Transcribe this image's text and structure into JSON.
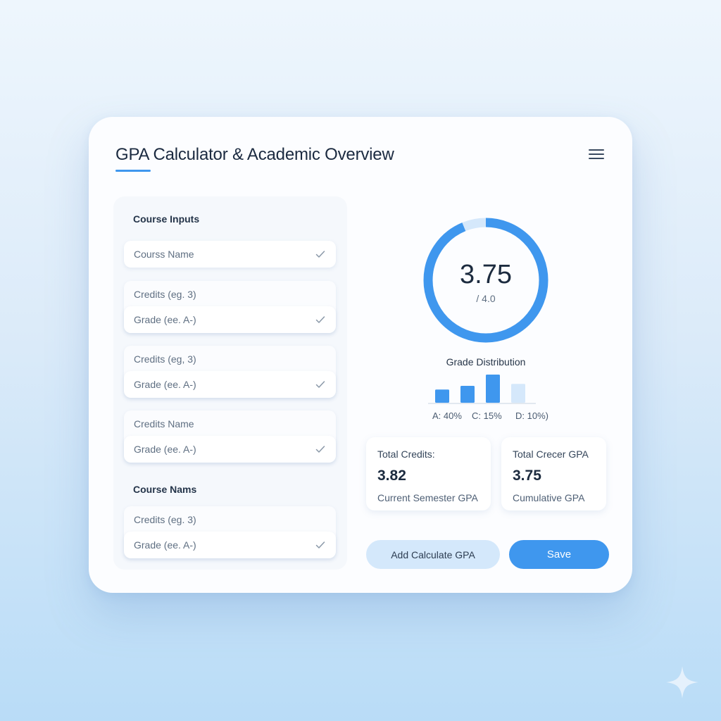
{
  "header": {
    "title": "GPA Calculator & Academic Overview",
    "menu_icon": "hamburger-menu-icon"
  },
  "course_panel": {
    "section1_title": "Course Inputs",
    "course_name_placeholder": "Courss Name",
    "rows": [
      {
        "top": "Credits (eg. 3)",
        "bottom": "Grade (ee. A-)"
      },
      {
        "top": "Credits (eg, 3)",
        "bottom": "Grade (ee. A-)"
      },
      {
        "top": "Credits Name",
        "bottom": "Grade (ee. A-)"
      }
    ],
    "section2_title": "Course Nams",
    "last_row": {
      "top": "Credits (eg. 3)",
      "bottom": "Grade (ee. A-)"
    },
    "field_icon": "check-icon"
  },
  "gpa_ring": {
    "value": "3.75",
    "scale": "/ 4.0",
    "fill_fraction": 0.9375,
    "fill_color": "#3f97ee",
    "track_color": "#d5e8fb"
  },
  "distribution": {
    "title": "Grade Distribution",
    "labels": [
      "A: 40%",
      "C: 15%",
      "D: 10%)"
    ],
    "bar_relative_heights": [
      0.47,
      0.6,
      1.0,
      0.67
    ],
    "bar_colors": [
      "#3f97ee",
      "#3f97ee",
      "#3f97ee",
      "#d5e8fb"
    ]
  },
  "stats": [
    {
      "label": "Total Credits:",
      "value": "3.82",
      "sub": "Current Semester GPA"
    },
    {
      "label": "Total Crecer GPA",
      "value": "3.75",
      "sub": "Cumulative GPA"
    }
  ],
  "buttons": {
    "secondary": "Add Calculate GPA",
    "primary": "Save"
  },
  "colors": {
    "accent": "#3f97ee",
    "accent_light": "#d4e8fb",
    "text_dark": "#1c2b3f"
  }
}
